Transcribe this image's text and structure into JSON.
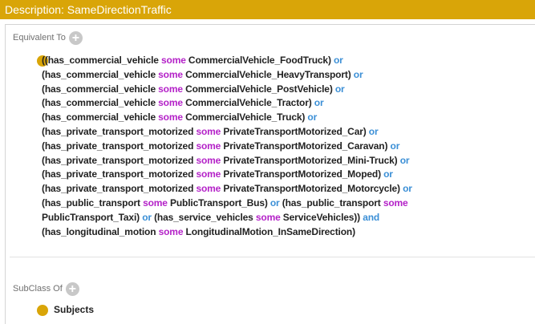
{
  "window": {
    "title": "Description: SameDirectionTraffic"
  },
  "sections": {
    "equivalent_to": "Equivalent To",
    "subclass_of": "SubClass Of",
    "add_symbol": "+"
  },
  "equivalent_expression": {
    "lines": [
      [
        [
          "t",
          "((has_commercial_vehicle "
        ],
        [
          "s",
          "some"
        ],
        [
          "t",
          " CommercialVehicle_FoodTruck) "
        ],
        [
          "o",
          "or"
        ]
      ],
      [
        [
          "t",
          "(has_commercial_vehicle "
        ],
        [
          "s",
          "some"
        ],
        [
          "t",
          " CommercialVehicle_HeavyTransport) "
        ],
        [
          "o",
          "or"
        ]
      ],
      [
        [
          "t",
          "(has_commercial_vehicle "
        ],
        [
          "s",
          "some"
        ],
        [
          "t",
          " CommercialVehicle_PostVehicle) "
        ],
        [
          "o",
          "or"
        ]
      ],
      [
        [
          "t",
          "(has_commercial_vehicle "
        ],
        [
          "s",
          "some"
        ],
        [
          "t",
          " CommercialVehicle_Tractor) "
        ],
        [
          "o",
          "or"
        ]
      ],
      [
        [
          "t",
          "(has_commercial_vehicle "
        ],
        [
          "s",
          "some"
        ],
        [
          "t",
          " CommercialVehicle_Truck) "
        ],
        [
          "o",
          "or"
        ]
      ],
      [
        [
          "t",
          "(has_private_transport_motorized "
        ],
        [
          "s",
          "some"
        ],
        [
          "t",
          " PrivateTransportMotorized_Car) "
        ],
        [
          "o",
          "or"
        ]
      ],
      [
        [
          "t",
          "(has_private_transport_motorized "
        ],
        [
          "s",
          "some"
        ],
        [
          "t",
          " PrivateTransportMotorized_Caravan) "
        ],
        [
          "o",
          "or"
        ]
      ],
      [
        [
          "t",
          "(has_private_transport_motorized "
        ],
        [
          "s",
          "some"
        ],
        [
          "t",
          " PrivateTransportMotorized_Mini-Truck) "
        ],
        [
          "o",
          "or"
        ]
      ],
      [
        [
          "t",
          "(has_private_transport_motorized "
        ],
        [
          "s",
          "some"
        ],
        [
          "t",
          " PrivateTransportMotorized_Moped) "
        ],
        [
          "o",
          "or"
        ]
      ],
      [
        [
          "t",
          "(has_private_transport_motorized "
        ],
        [
          "s",
          "some"
        ],
        [
          "t",
          " PrivateTransportMotorized_Motorcycle) "
        ],
        [
          "o",
          "or"
        ]
      ],
      [
        [
          "t",
          "(has_public_transport "
        ],
        [
          "s",
          "some"
        ],
        [
          "t",
          " PublicTransport_Bus) "
        ],
        [
          "o",
          "or"
        ],
        [
          "t",
          " (has_public_transport "
        ],
        [
          "s",
          "some"
        ]
      ],
      [
        [
          "t",
          "PublicTransport_Taxi) "
        ],
        [
          "o",
          "or"
        ],
        [
          "t",
          " (has_service_vehicles "
        ],
        [
          "s",
          "some"
        ],
        [
          "t",
          " ServiceVehicles)) "
        ],
        [
          "o",
          "and"
        ]
      ],
      [
        [
          "t",
          "(has_longitudinal_motion "
        ],
        [
          "s",
          "some"
        ],
        [
          "t",
          " LongitudinalMotion_InSameDirection)"
        ]
      ]
    ]
  },
  "subclass_of_items": [
    {
      "label": "Subjects"
    }
  ],
  "colors": {
    "title_bg": "#d9a508",
    "class_dot": "#d9a508",
    "keyword_or": "#3b8fd6",
    "keyword_some": "#b422c8"
  }
}
